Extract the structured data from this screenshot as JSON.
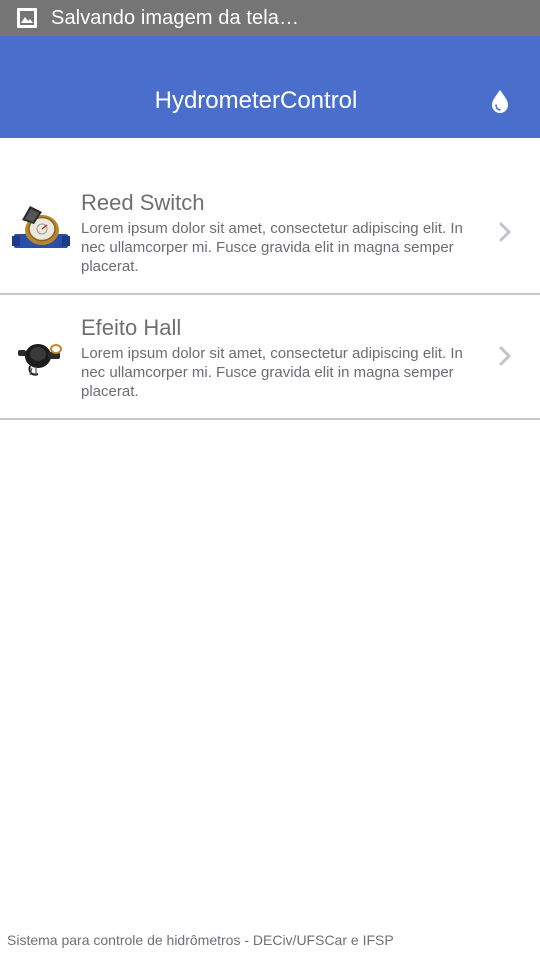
{
  "status_bar": {
    "text": "Salvando imagem da tela…",
    "icon": "image-icon"
  },
  "app_bar": {
    "title": "HydrometerControl",
    "action_icon": "water-drop-icon"
  },
  "items": [
    {
      "title": "Reed Switch",
      "description": "Lorem ipsum dolor sit amet, consectetur adipiscing elit. In nec ullamcorper mi. Fusce gravida elit in magna semper placerat.",
      "icon": "water-meter-icon"
    },
    {
      "title": "Efeito Hall",
      "description": "Lorem ipsum dolor sit amet, consectetur adipiscing elit. In nec ullamcorper mi. Fusce gravida elit in magna semper placerat.",
      "icon": "hall-sensor-icon"
    }
  ],
  "footer": {
    "text": "Sistema para controle de hidrômetros - DECiv/UFSCar e IFSP"
  },
  "colors": {
    "app_bar": "#4a6ecc",
    "status_bar": "#757575",
    "divider": "#c9c9c9"
  }
}
